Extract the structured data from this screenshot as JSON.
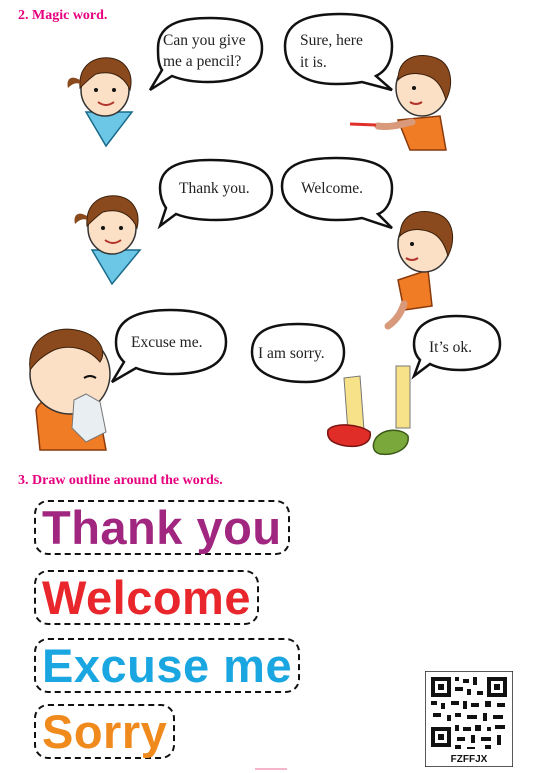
{
  "sections": {
    "magic_word": {
      "heading": "2. Magic word."
    },
    "draw_outline": {
      "heading": "3. Draw outline around the words."
    }
  },
  "bubbles": {
    "b1": {
      "line1": "Can you give",
      "line2": "me a pencil?"
    },
    "b2": {
      "line1": "Sure, here",
      "line2": "it is."
    },
    "b3": {
      "text": "Thank you."
    },
    "b4": {
      "text": "Welcome."
    },
    "b5": {
      "text": "Excuse me."
    },
    "b6": {
      "text": "I am sorry."
    },
    "b7": {
      "text": "It’s ok."
    }
  },
  "words": [
    {
      "text": "Thank you",
      "color": "#a0267f"
    },
    {
      "text": "Welcome",
      "color": "#e8262b"
    },
    {
      "text": "Excuse me",
      "color": "#1aa6e0"
    },
    {
      "text": "Sorry",
      "color": "#f08a1d"
    }
  ],
  "qr": {
    "code": "FZFFJX"
  },
  "colors": {
    "heading": "#e6007e",
    "girl_top": "#6cc7e6",
    "boy_shirt": "#f07c26",
    "shoe_red": "#e02d27",
    "shoe_green": "#7aa83b"
  }
}
